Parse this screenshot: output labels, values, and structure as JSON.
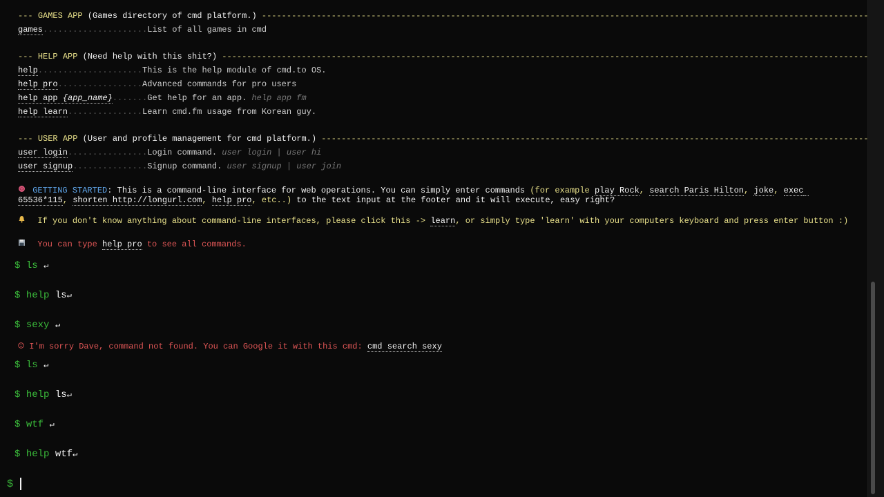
{
  "games_section": {
    "dashes_left": "---",
    "app_name": "GAMES APP",
    "desc": "(Games directory of cmd platform.)",
    "dashes_right": "------------------------------------------------------------------------------------------------------------------------------",
    "items": [
      {
        "cmd": "games",
        "dots": ".....................",
        "desc": "List of all games in cmd",
        "example": ""
      }
    ]
  },
  "help_section": {
    "dashes_left": "---",
    "app_name": "HELP APP",
    "desc": "(Need help with this shit?)",
    "dashes_right": "--------------------------------------------------------------------------------------------------------------------------------------",
    "items": [
      {
        "cmd": "help",
        "dots": ".....................",
        "desc": "This is the help module of cmd.to OS.",
        "example": ""
      },
      {
        "cmd": "help pro",
        "dots": ".................",
        "desc": "Advanced commands for pro users",
        "example": ""
      },
      {
        "cmd_plain": "help app ",
        "cmd_italic": "{app_name}",
        "dots": ".......",
        "desc": "Get help for an app.",
        "example": "help app fm"
      },
      {
        "cmd": "help learn",
        "dots": "...............",
        "desc": "Learn cmd.fm usage from Korean guy.",
        "example": ""
      }
    ]
  },
  "user_section": {
    "dashes_left": "---",
    "app_name": "USER APP",
    "desc": "(User and profile management for cmd platform.)",
    "dashes_right": "-----------------------------------------------------------------------------------------------------------------",
    "items": [
      {
        "cmd": "user login",
        "dots": "................",
        "desc": "Login command.",
        "example": "user login | user hi"
      },
      {
        "cmd": "user signup",
        "dots": "...............",
        "desc": "Signup command.",
        "example": "user signup | user join"
      }
    ]
  },
  "getting_started": {
    "icon": "brain-icon",
    "label": "GETTING STARTED",
    "text1": ": This is a command-line interface for web operations. You can simply enter commands ",
    "paren_open": "(for example ",
    "ex1": "play Rock",
    "ex2": "search Paris Hilton",
    "ex3": "joke",
    "ex4a": "exec",
    "ex4b": "65536*115",
    "ex5": "shorten http://longurl.com",
    "ex6": "help pro",
    "etc": ", etc..)",
    "text2": " to the text input at the footer and it will execute, easy right?"
  },
  "bell_note": {
    "icon": "bell-icon",
    "text1": "If you don't know anything about command-line interfaces, please click this -> ",
    "link": "learn",
    "text2": ", or simply type 'learn' with your computers keyboard and press enter button :)"
  },
  "disk_note": {
    "icon": "floppy-disk-icon",
    "text1": "You can type ",
    "link": "help pro",
    "text2": " to see all commands."
  },
  "history": [
    {
      "dollar": "$",
      "cmd": "ls",
      "arg": "",
      "enter": "↵"
    },
    {
      "dollar": "$",
      "cmd": "help",
      "arg": "ls",
      "enter": "↵"
    },
    {
      "dollar": "$",
      "cmd": "sexy",
      "arg": "",
      "enter": "↵"
    },
    {
      "dollar": "$",
      "cmd": "ls",
      "arg": "",
      "enter": "↵"
    },
    {
      "dollar": "$",
      "cmd": "help",
      "arg": "ls",
      "enter": "↵"
    },
    {
      "dollar": "$",
      "cmd": "wtf",
      "arg": "",
      "enter": "↵"
    },
    {
      "dollar": "$",
      "cmd": "help",
      "arg": "wtf",
      "enter": "↵"
    }
  ],
  "error": {
    "icon": "sad-face-icon",
    "text": "I'm sorry Dave, command not found. You can Google it with this cmd: ",
    "link": "cmd search sexy"
  },
  "input": {
    "dollar": "$",
    "value": ""
  },
  "colors": {
    "background": "#0a0a0a",
    "prompt_green": "#3bbd3b",
    "header_yellow": "#e8e08a",
    "error_red": "#e05656",
    "started_blue": "#5ea4e8"
  }
}
